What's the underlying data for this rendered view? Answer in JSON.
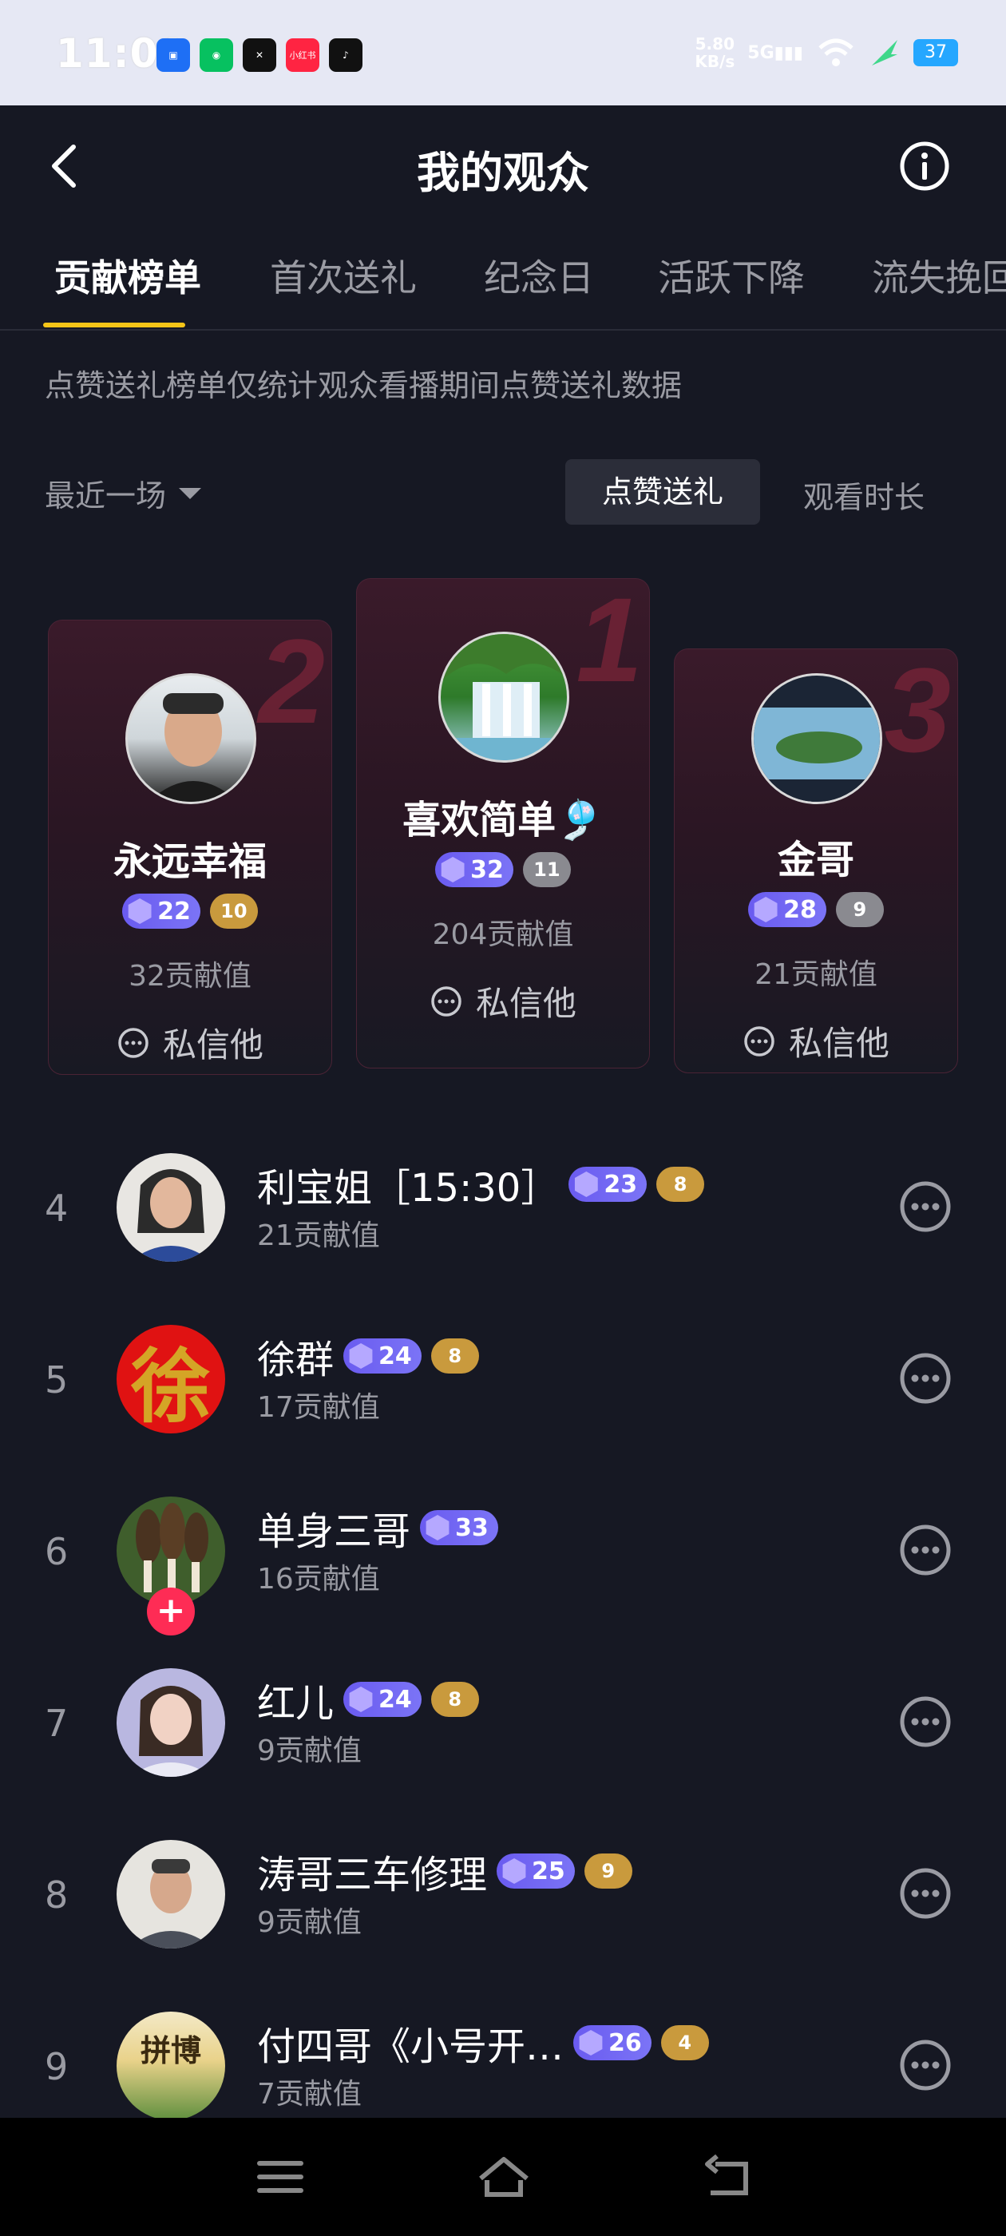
{
  "status_bar": {
    "time": "11:01",
    "apps": [
      "小红书"
    ],
    "net_speed": "5.80\nKB/s",
    "signal": "5G",
    "battery": "37"
  },
  "header": {
    "title": "我的观众"
  },
  "tabs": [
    {
      "label": "贡献榜单",
      "active": true
    },
    {
      "label": "首次送礼"
    },
    {
      "label": "纪念日"
    },
    {
      "label": "活跃下降"
    },
    {
      "label": "流失挽回"
    }
  ],
  "notice": "点赞送礼榜单仅统计观众看播期间点赞送礼数据",
  "filter": {
    "period": "最近一场"
  },
  "segments": {
    "active": "点赞送礼",
    "other": "观看时长"
  },
  "podium": [
    {
      "rank": "2",
      "name": "永远幸福",
      "level": "22",
      "fan": "10",
      "contribution": "32贡献值",
      "message": "私信他"
    },
    {
      "rank": "1",
      "name": "喜欢简单🎐",
      "level": "32",
      "fan": "11",
      "contribution": "204贡献值",
      "message": "私信他"
    },
    {
      "rank": "3",
      "name": "金哥",
      "level": "28",
      "fan": "9",
      "contribution": "21贡献值",
      "message": "私信他"
    }
  ],
  "list": [
    {
      "rank": "4",
      "name": "利宝姐［15:30］",
      "level": "23",
      "fan": "8",
      "contribution": "21贡献值"
    },
    {
      "rank": "5",
      "name": "徐群",
      "level": "24",
      "fan": "8",
      "contribution": "17贡献值",
      "avatar_text": "徐"
    },
    {
      "rank": "6",
      "name": "单身三哥",
      "level": "33",
      "fan": "",
      "contribution": "16贡献值"
    },
    {
      "rank": "7",
      "name": "红儿",
      "level": "24",
      "fan": "8",
      "contribution": "9贡献值"
    },
    {
      "rank": "8",
      "name": "涛哥三车修理",
      "level": "25",
      "fan": "9",
      "contribution": "9贡献值"
    },
    {
      "rank": "9",
      "name": "付四哥《小号开…",
      "level": "26",
      "fan": "4",
      "contribution": "7贡献值",
      "avatar_text": "拼博"
    }
  ]
}
